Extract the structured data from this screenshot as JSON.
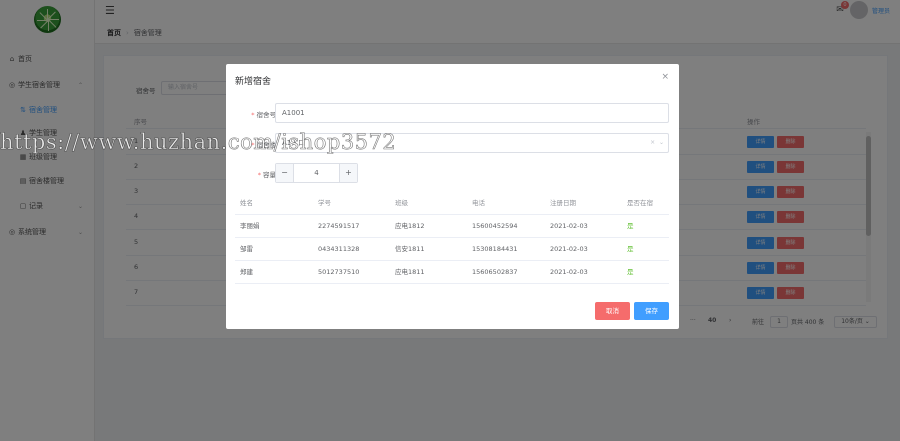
{
  "sidebar": {
    "items": [
      {
        "label": "首页",
        "icon": "home-icon"
      },
      {
        "label": "学生宿舍管理",
        "icon": "location-icon"
      },
      {
        "label": "宿舍管理",
        "icon": "sort-icon",
        "active": true
      },
      {
        "label": "学生管理",
        "icon": "user-icon"
      },
      {
        "label": "班级管理",
        "icon": "grid-icon"
      },
      {
        "label": "宿舍楼管理",
        "icon": "building-icon"
      },
      {
        "label": "记录",
        "icon": "document-icon"
      },
      {
        "label": "系统管理",
        "icon": "location-icon"
      }
    ]
  },
  "header": {
    "notification_count": "0",
    "user_name": "管理员"
  },
  "breadcrumb": {
    "home": "首页",
    "current": "宿舍管理"
  },
  "search": {
    "label": "宿舍号",
    "placeholder": "输入宿舍号"
  },
  "main_table": {
    "headers": {
      "no": "序号",
      "op": "操作"
    },
    "rows": [
      "1",
      "2",
      "3",
      "4",
      "5",
      "6",
      "7"
    ],
    "detail_label": "详情",
    "delete_label": "删除"
  },
  "pagination": {
    "ellipsis": "···",
    "last_page": "40",
    "next": "›",
    "goto_prefix": "前往",
    "goto_value": "1",
    "goto_suffix": "页共 400 条",
    "page_size": "10条/页"
  },
  "modal": {
    "title": "新增宿舍",
    "close": "×",
    "fields": {
      "dorm_no_label": "宿舍号",
      "dorm_no_value": "A1001",
      "building_label": "宿舍楼",
      "building_value": "A1入口",
      "capacity_label": "容量",
      "capacity_value": "4"
    },
    "table": {
      "headers": [
        "姓名",
        "学号",
        "班级",
        "电话",
        "注册日期",
        "是否在宿"
      ],
      "rows": [
        [
          "李丽娟",
          "2274591517",
          "应电1812",
          "15600452594",
          "2021-02-03",
          "是"
        ],
        [
          "邹雷",
          "0434311328",
          "信安1811",
          "15308184431",
          "2021-02-03",
          "是"
        ],
        [
          "郑建",
          "5012737510",
          "应电1811",
          "15606502837",
          "2021-02-03",
          "是"
        ]
      ]
    },
    "cancel_label": "取消",
    "save_label": "保存"
  },
  "watermark": "https://www.huzhan.com/ishop3572",
  "colors": {
    "primary": "#409eff",
    "danger": "#f56c6c",
    "success": "#67c23a"
  }
}
